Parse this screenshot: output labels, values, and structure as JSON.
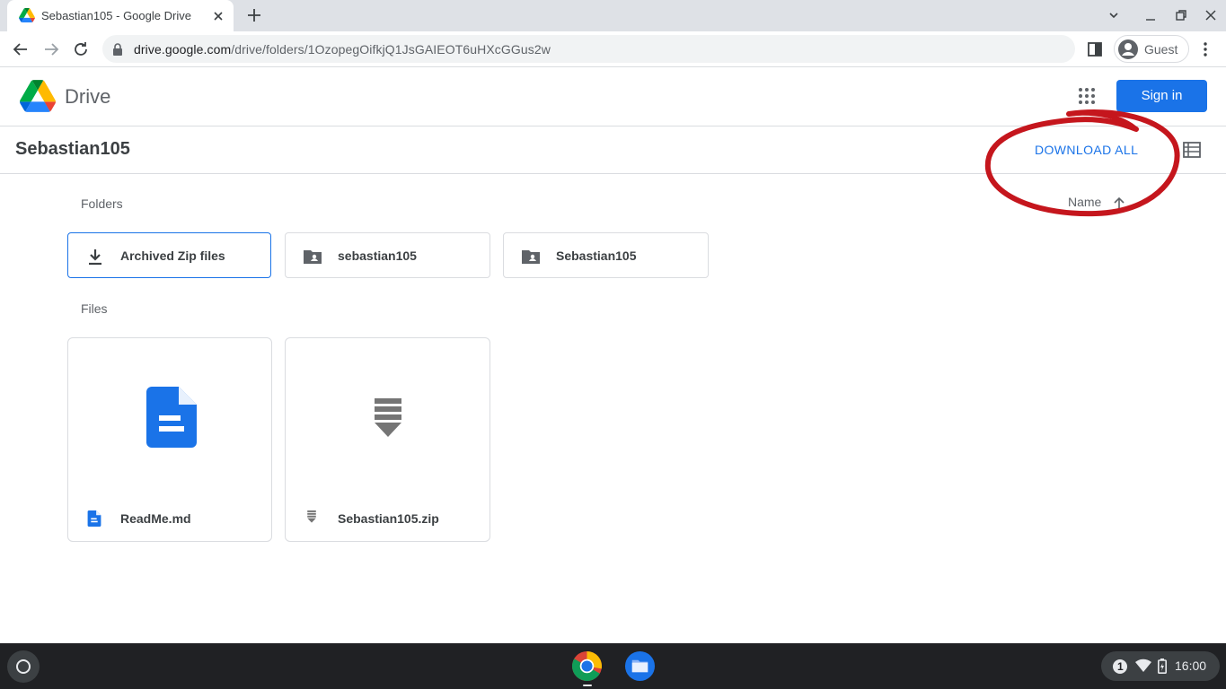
{
  "browser": {
    "tab_title": "Sebastian105 - Google Drive",
    "url_host": "drive.google.com",
    "url_path": "/drive/folders/1OzopegOifkjQ1JsGAIEOT6uHXcGGus2w",
    "profile_label": "Guest"
  },
  "header": {
    "product_name": "Drive",
    "sign_in_label": "Sign in"
  },
  "folder": {
    "title": "Sebastian105",
    "download_all_label": "DOWNLOAD ALL",
    "sort_label": "Name"
  },
  "sections": {
    "folders_label": "Folders",
    "files_label": "Files"
  },
  "folders": [
    {
      "name": "Archived Zip files",
      "icon": "download-icon",
      "selected": true
    },
    {
      "name": "sebastian105",
      "icon": "shared-folder-icon",
      "selected": false
    },
    {
      "name": "Sebastian105",
      "icon": "shared-folder-icon",
      "selected": false
    }
  ],
  "files": [
    {
      "name": "ReadMe.md",
      "icon": "doc-icon",
      "color": "#1a73e8"
    },
    {
      "name": "Sebastian105.zip",
      "icon": "zip-icon",
      "color": "#757575"
    }
  ],
  "shelf": {
    "clock": "16:00",
    "notification_count": "1"
  },
  "colors": {
    "accent": "#1a73e8",
    "annotation": "#c5161d"
  }
}
